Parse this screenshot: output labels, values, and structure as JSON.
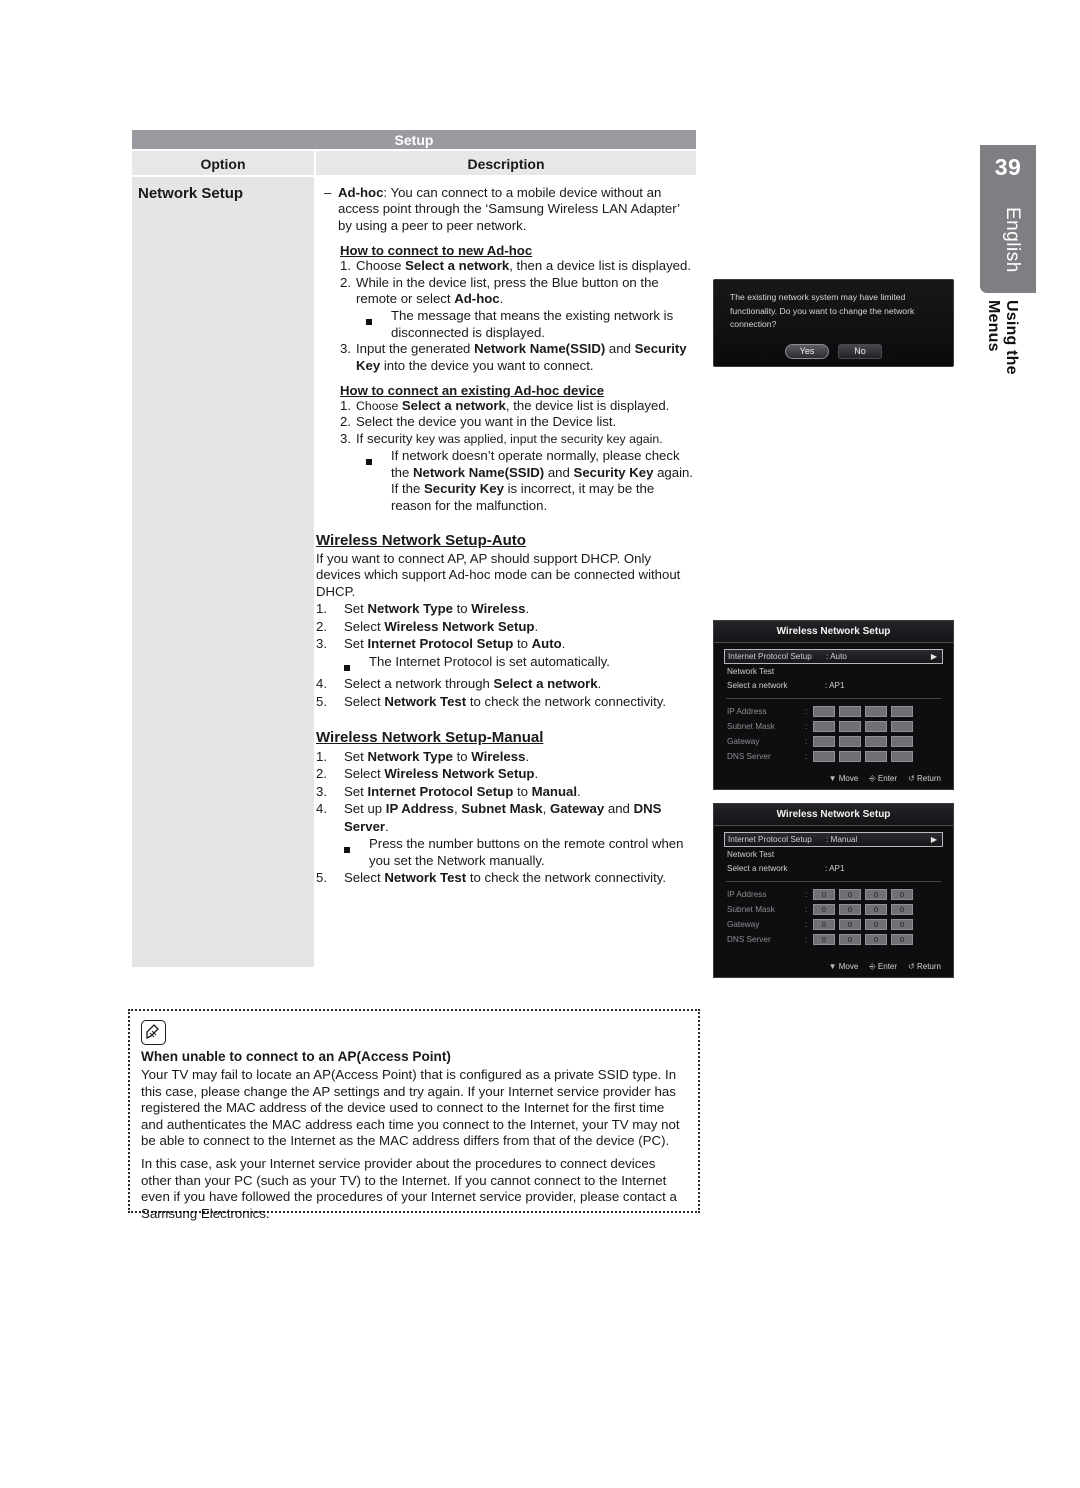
{
  "side_tab": {
    "page_number": "39",
    "language": "English",
    "chapter": "Using the Menus"
  },
  "table": {
    "title": "Setup",
    "headers": {
      "option": "Option",
      "description": "Description"
    },
    "option_label": "Network Setup",
    "adhoc_dash": "–",
    "adhoc_term": "Ad-hoc",
    "adhoc_text": ": You can connect to a mobile device without an access point through the ‘Samsung Wireless LAN Adapter’ by using a peer to peer network.",
    "new_adhoc": {
      "heading": "How to connect to new Ad-hoc",
      "items": [
        {
          "num": "1.",
          "pre": "Choose ",
          "bold": "Select a network",
          "post": ", then a device list is displayed."
        },
        {
          "num": "2.",
          "pre": "While in the device list, press the Blue button on the remote or select ",
          "bold": "Ad-hoc",
          "post": "."
        }
      ],
      "bullet": "The message that means the existing network is disconnected is displayed.",
      "item3": {
        "num": "3.",
        "pre": "Input the generated ",
        "bold": "Network Name(SSID)",
        "mid": " and ",
        "bold2": "Security Key",
        "post": " into the device you want to connect."
      }
    },
    "existing_adhoc": {
      "heading": "How to connect an existing Ad-hoc device",
      "item1": {
        "num": "1.",
        "pre": "Choose ",
        "bold": "Select a network",
        "post": ", the device list is displayed."
      },
      "item2": {
        "num": "2.",
        "text": "Select the device you want in the Device list."
      },
      "item3": {
        "num": "3.",
        "pre": "If security",
        "post": " key was applied, input the security key again."
      },
      "bullet": {
        "pre": "If network doesn’t operate normally, please check the ",
        "bold": "Network Name(SSID)",
        "mid": " and ",
        "bold2": "Security Key",
        "mid2": " again. If the ",
        "bold3": "Security Key",
        "post": " is incorrect, it may be the reason for the malfunction."
      }
    },
    "auto": {
      "heading": "Wireless Network Setup-Auto",
      "intro": "If you want to connect AP, AP should support DHCP. Only devices which support Ad-hoc mode can be connected without DHCP.",
      "steps": [
        {
          "num": "1.",
          "pre": "Set ",
          "bold": "Network Type",
          "mid": " to ",
          "bold2": "Wireless",
          "post": "."
        },
        {
          "num": "2.",
          "pre": "Select ",
          "bold": "Wireless Network Setup",
          "post": "."
        },
        {
          "num": "3.",
          "pre": "Set ",
          "bold": "Internet Protocol Setup",
          "mid": " to ",
          "bold2": "Auto",
          "post": "."
        }
      ],
      "bullet": "The Internet Protocol is set automatically.",
      "steps2": [
        {
          "num": "4.",
          "pre": "Select a network through ",
          "bold": "Select a network",
          "post": "."
        },
        {
          "num": "5.",
          "pre": "Select ",
          "bold": "Network Test",
          "post": " to check the network connectivity."
        }
      ]
    },
    "manual": {
      "heading": "Wireless Network Setup-Manual",
      "steps": [
        {
          "num": "1.",
          "pre": "Set ",
          "bold": "Network Type",
          "mid": " to ",
          "bold2": "Wireless",
          "post": "."
        },
        {
          "num": "2.",
          "pre": "Select ",
          "bold": "Wireless Network Setup",
          "post": "."
        },
        {
          "num": "3.",
          "pre": "Set ",
          "bold": "Internet Protocol Setup",
          "mid": " to ",
          "bold2": "Manual",
          "post": "."
        },
        {
          "num": "4.",
          "pre": "Set up ",
          "bold": "IP Address",
          "mid": ", ",
          "bold2": "Subnet Mask",
          "mid2": ", ",
          "bold3": "Gateway",
          "mid3": " and ",
          "bold4": "DNS Server",
          "post": "."
        }
      ],
      "bullet": "Press the number buttons on the remote control when you set the Network manually.",
      "step5": {
        "num": "5.",
        "pre": "Select ",
        "bold": "Network Test",
        "post": " to check the network connectivity."
      }
    }
  },
  "tv_dialog": {
    "message": "The existing network system may have limited functionality. Do you want to change the network connection?",
    "yes_label": "Yes",
    "no_label": "No"
  },
  "tv_menu_auto": {
    "title": "Wireless Network Setup",
    "rows": [
      {
        "label": "Internet Protocol Setup",
        "value": ": Auto",
        "arrow": "▶"
      },
      {
        "label": "Network Test",
        "value": ""
      },
      {
        "label": "Select a network",
        "value": ": AP1"
      }
    ],
    "ip_rows": [
      {
        "label": "IP Address",
        "colon": ":",
        "values": [
          "",
          "",
          "",
          ""
        ]
      },
      {
        "label": "Subnet Mask",
        "colon": ":",
        "values": [
          "",
          "",
          "",
          ""
        ]
      },
      {
        "label": "Gateway",
        "colon": ":",
        "values": [
          "",
          "",
          "",
          ""
        ]
      },
      {
        "label": "DNS Server",
        "colon": ":",
        "values": [
          "",
          "",
          "",
          ""
        ]
      }
    ],
    "footer": {
      "move": "Move",
      "enter": "Enter",
      "return": "Return"
    }
  },
  "tv_menu_manual": {
    "title": "Wireless Network Setup",
    "rows": [
      {
        "label": "Internet Protocol Setup",
        "value": ": Manual",
        "arrow": "▶"
      },
      {
        "label": "Network Test",
        "value": ""
      },
      {
        "label": "Select a network",
        "value": ": AP1"
      }
    ],
    "ip_rows": [
      {
        "label": "IP Address",
        "colon": ":",
        "values": [
          "0",
          "0",
          "0",
          "0"
        ]
      },
      {
        "label": "Subnet Mask",
        "colon": ":",
        "values": [
          "0",
          "0",
          "0",
          "0"
        ]
      },
      {
        "label": "Gateway",
        "colon": ":",
        "values": [
          "0",
          "0",
          "0",
          "0"
        ]
      },
      {
        "label": "DNS Server",
        "colon": ":",
        "values": [
          "0",
          "0",
          "0",
          "0"
        ]
      }
    ],
    "footer": {
      "move": "Move",
      "enter": "Enter",
      "return": "Return"
    }
  },
  "note": {
    "title": "When unable to connect to an AP(Access Point)",
    "paragraph1": "Your TV may fail to locate an AP(Access Point) that is configured as a private SSID type. In this case, please change the AP settings and try again. If your Internet service provider has registered the MAC address of the device used to connect to the Internet for the first time and authenticates the MAC address each time you connect to the Internet, your TV may not be able to connect to the Internet as the MAC address differs from that of the device (PC).",
    "paragraph2": "In this case, ask your Internet service provider about the procedures to connect devices other than your PC (such as your TV) to the Internet. If you cannot connect to the Internet even if you have followed the procedures of your Internet service provider, please contact a Samsung Electronics."
  },
  "colors": {
    "table_title_bg": "#9a9ba0",
    "table_head_bg": "#e6e7e9",
    "option_cell_bg": "#e3e5e7",
    "side_tab_bg": "#7d7f83",
    "tv_bg": "#0e0e10"
  }
}
